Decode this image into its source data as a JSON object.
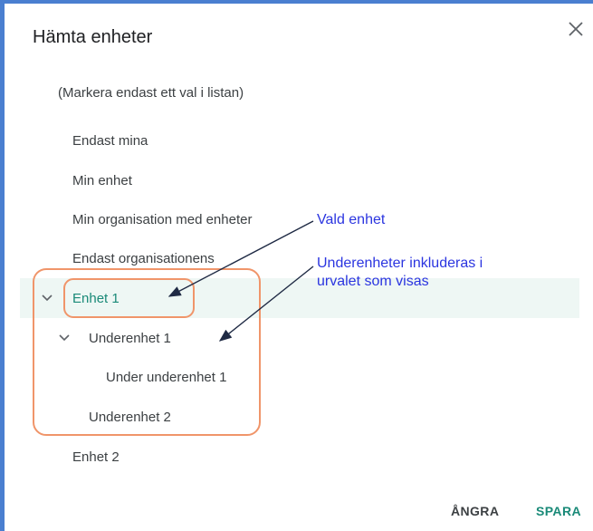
{
  "dialog": {
    "title": "Hämta enheter",
    "hint": "(Markera endast ett val i listan)"
  },
  "options": [
    "Endast mina",
    "Min enhet",
    "Min organisation med enheter",
    "Endast organisationens"
  ],
  "tree": {
    "unit1": "Enhet 1",
    "subunit1": "Underenhet 1",
    "subsubunit1": "Under underenhet 1",
    "subunit2": "Underenhet 2",
    "unit2": "Enhet 2"
  },
  "actions": {
    "undo": "ÅNGRA",
    "save": "SPARA"
  },
  "annotations": {
    "selected_unit": "Vald enhet",
    "subunits_line1": "Underenheter inkluderas i",
    "subunits_line2": "urvalet som visas",
    "color": "#2b35e0",
    "highlight_color": "#f0956a"
  },
  "colors": {
    "accent": "#1a8a78",
    "selected_row": "#eef7f4",
    "frame": "#4a7fd0"
  },
  "icons": {
    "close": "close-icon",
    "expand": "chevron-down-icon"
  }
}
